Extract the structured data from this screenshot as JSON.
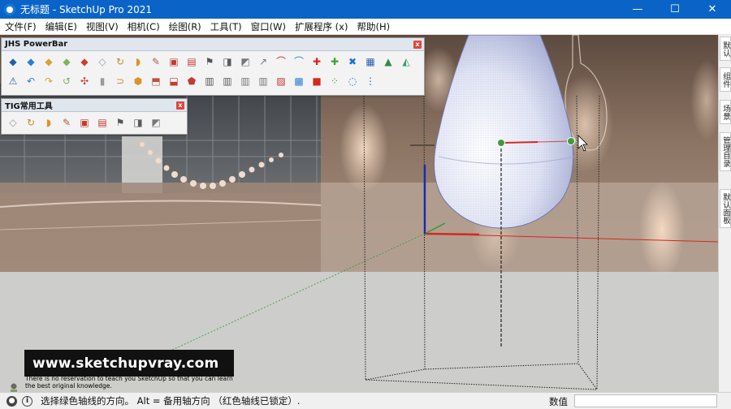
{
  "window": {
    "title": "无标题 - SketchUp Pro 2021",
    "controls": {
      "minimize": "—",
      "maximize": "☐",
      "close": "✕"
    }
  },
  "menubar": {
    "items": [
      "文件(F)",
      "编辑(E)",
      "视图(V)",
      "相机(C)",
      "绘图(R)",
      "工具(T)",
      "窗口(W)",
      "扩展程序 (x)",
      "帮助(H)"
    ]
  },
  "toolbars": {
    "jhs": {
      "title": "JHS PowerBar",
      "close": "x",
      "row1_icons": [
        "push-pull-icon",
        "shape-icon",
        "extrude-icon",
        "follow-icon",
        "paint-icon",
        "eraser-icon",
        "rotate-icon",
        "paint-bucket-icon",
        "brush-icon",
        "frame-icon",
        "frame2-icon",
        "flag-icon",
        "sofa-icon",
        "loft-icon",
        "corner-icon",
        "curve-icon",
        "arc-icon",
        "cross-red-icon",
        "cross-green-icon",
        "x-blue-icon",
        "grid-icon",
        "prism-icon",
        "flask-icon"
      ],
      "row2_icons": [
        "warning-icon",
        "bend-icon",
        "twist-icon",
        "refresh-icon",
        "move-icon",
        "cylinder-icon",
        "u-turn-icon",
        "component-icon",
        "export-icon",
        "box-icon",
        "ruby-icon",
        "array-icon",
        "array2-icon",
        "array3-icon",
        "array4-icon",
        "hatch-icon",
        "fill-icon",
        "solid-icon",
        "scatter-icon",
        "dots-arc-icon",
        "grid-dots-icon"
      ]
    },
    "tig": {
      "title": "TIG常用工具",
      "close": "x",
      "icons": [
        "tig-tool-1-icon",
        "tig-tool-2-icon",
        "tig-tool-3-icon",
        "tig-tool-4-icon",
        "tig-tool-5-icon",
        "tig-tool-6-icon",
        "tig-tool-7-icon",
        "tig-tool-8-icon",
        "tig-tool-9-icon"
      ]
    }
  },
  "tray": {
    "tabs": [
      "默认",
      "组件",
      "场景",
      "管理目录",
      "默认面板"
    ]
  },
  "watermark": {
    "url": "www.sketchupvray.com",
    "tagline": "There is no reservation to teach you SketchUp so that you can learn the best original knowledge."
  },
  "statusbar": {
    "message": "选择绿色轴线的方向。 Alt = 备用轴方向 （红色轴线已锁定）.",
    "value_label": "数值",
    "value": ""
  },
  "colors": {
    "titlebar": "#0a64c8",
    "axis_red": "#d6281e",
    "axis_green": "#2f9a3a",
    "axis_blue": "#1b2fd6",
    "inference_point": "#3d9a3d"
  }
}
